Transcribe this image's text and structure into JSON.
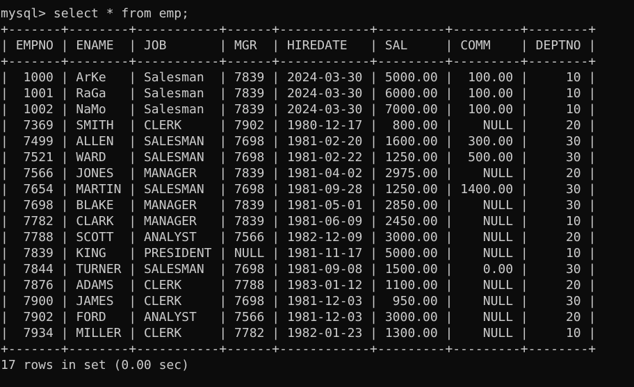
{
  "window": {
    "background": "#0c0c0c",
    "foreground": "#cccccc"
  },
  "prompt": "mysql>",
  "command": "select * from emp;",
  "table": {
    "border": "+-------+--------+-----------+------+------------+---------+---------+--------+",
    "columns": [
      {
        "name": "EMPNO",
        "width": 5,
        "align": "right"
      },
      {
        "name": "ENAME",
        "width": 6,
        "align": "left"
      },
      {
        "name": "JOB",
        "width": 9,
        "align": "left"
      },
      {
        "name": "MGR",
        "width": 4,
        "align": "left"
      },
      {
        "name": "HIREDATE",
        "width": 10,
        "align": "left"
      },
      {
        "name": "SAL",
        "width": 7,
        "align": "right"
      },
      {
        "name": "COMM",
        "width": 7,
        "align": "right"
      },
      {
        "name": "DEPTNO",
        "width": 6,
        "align": "right"
      }
    ],
    "rows": [
      [
        "1000",
        "ArKe",
        "Salesman",
        "7839",
        "2024-03-30",
        "5000.00",
        "100.00",
        "10"
      ],
      [
        "1001",
        "RaGa",
        "Salesman",
        "7839",
        "2024-03-30",
        "6000.00",
        "100.00",
        "10"
      ],
      [
        "1002",
        "NaMo",
        "Salesman",
        "7839",
        "2024-03-30",
        "7000.00",
        "100.00",
        "10"
      ],
      [
        "7369",
        "SMITH",
        "CLERK",
        "7902",
        "1980-12-17",
        "800.00",
        "NULL",
        "20"
      ],
      [
        "7499",
        "ALLEN",
        "SALESMAN",
        "7698",
        "1981-02-20",
        "1600.00",
        "300.00",
        "30"
      ],
      [
        "7521",
        "WARD",
        "SALESMAN",
        "7698",
        "1981-02-22",
        "1250.00",
        "500.00",
        "30"
      ],
      [
        "7566",
        "JONES",
        "MANAGER",
        "7839",
        "1981-04-02",
        "2975.00",
        "NULL",
        "20"
      ],
      [
        "7654",
        "MARTIN",
        "SALESMAN",
        "7698",
        "1981-09-28",
        "1250.00",
        "1400.00",
        "30"
      ],
      [
        "7698",
        "BLAKE",
        "MANAGER",
        "7839",
        "1981-05-01",
        "2850.00",
        "NULL",
        "30"
      ],
      [
        "7782",
        "CLARK",
        "MANAGER",
        "7839",
        "1981-06-09",
        "2450.00",
        "NULL",
        "10"
      ],
      [
        "7788",
        "SCOTT",
        "ANALYST",
        "7566",
        "1982-12-09",
        "3000.00",
        "NULL",
        "20"
      ],
      [
        "7839",
        "KING",
        "PRESIDENT",
        "NULL",
        "1981-11-17",
        "5000.00",
        "NULL",
        "10"
      ],
      [
        "7844",
        "TURNER",
        "SALESMAN",
        "7698",
        "1981-09-08",
        "1500.00",
        "0.00",
        "30"
      ],
      [
        "7876",
        "ADAMS",
        "CLERK",
        "7788",
        "1983-01-12",
        "1100.00",
        "NULL",
        "20"
      ],
      [
        "7900",
        "JAMES",
        "CLERK",
        "7698",
        "1981-12-03",
        "950.00",
        "NULL",
        "30"
      ],
      [
        "7902",
        "FORD",
        "ANALYST",
        "7566",
        "1981-12-03",
        "3000.00",
        "NULL",
        "20"
      ],
      [
        "7934",
        "MILLER",
        "CLERK",
        "7782",
        "1982-01-23",
        "1300.00",
        "NULL",
        "10"
      ]
    ]
  },
  "footer": "17 rows in set (0.00 sec)"
}
